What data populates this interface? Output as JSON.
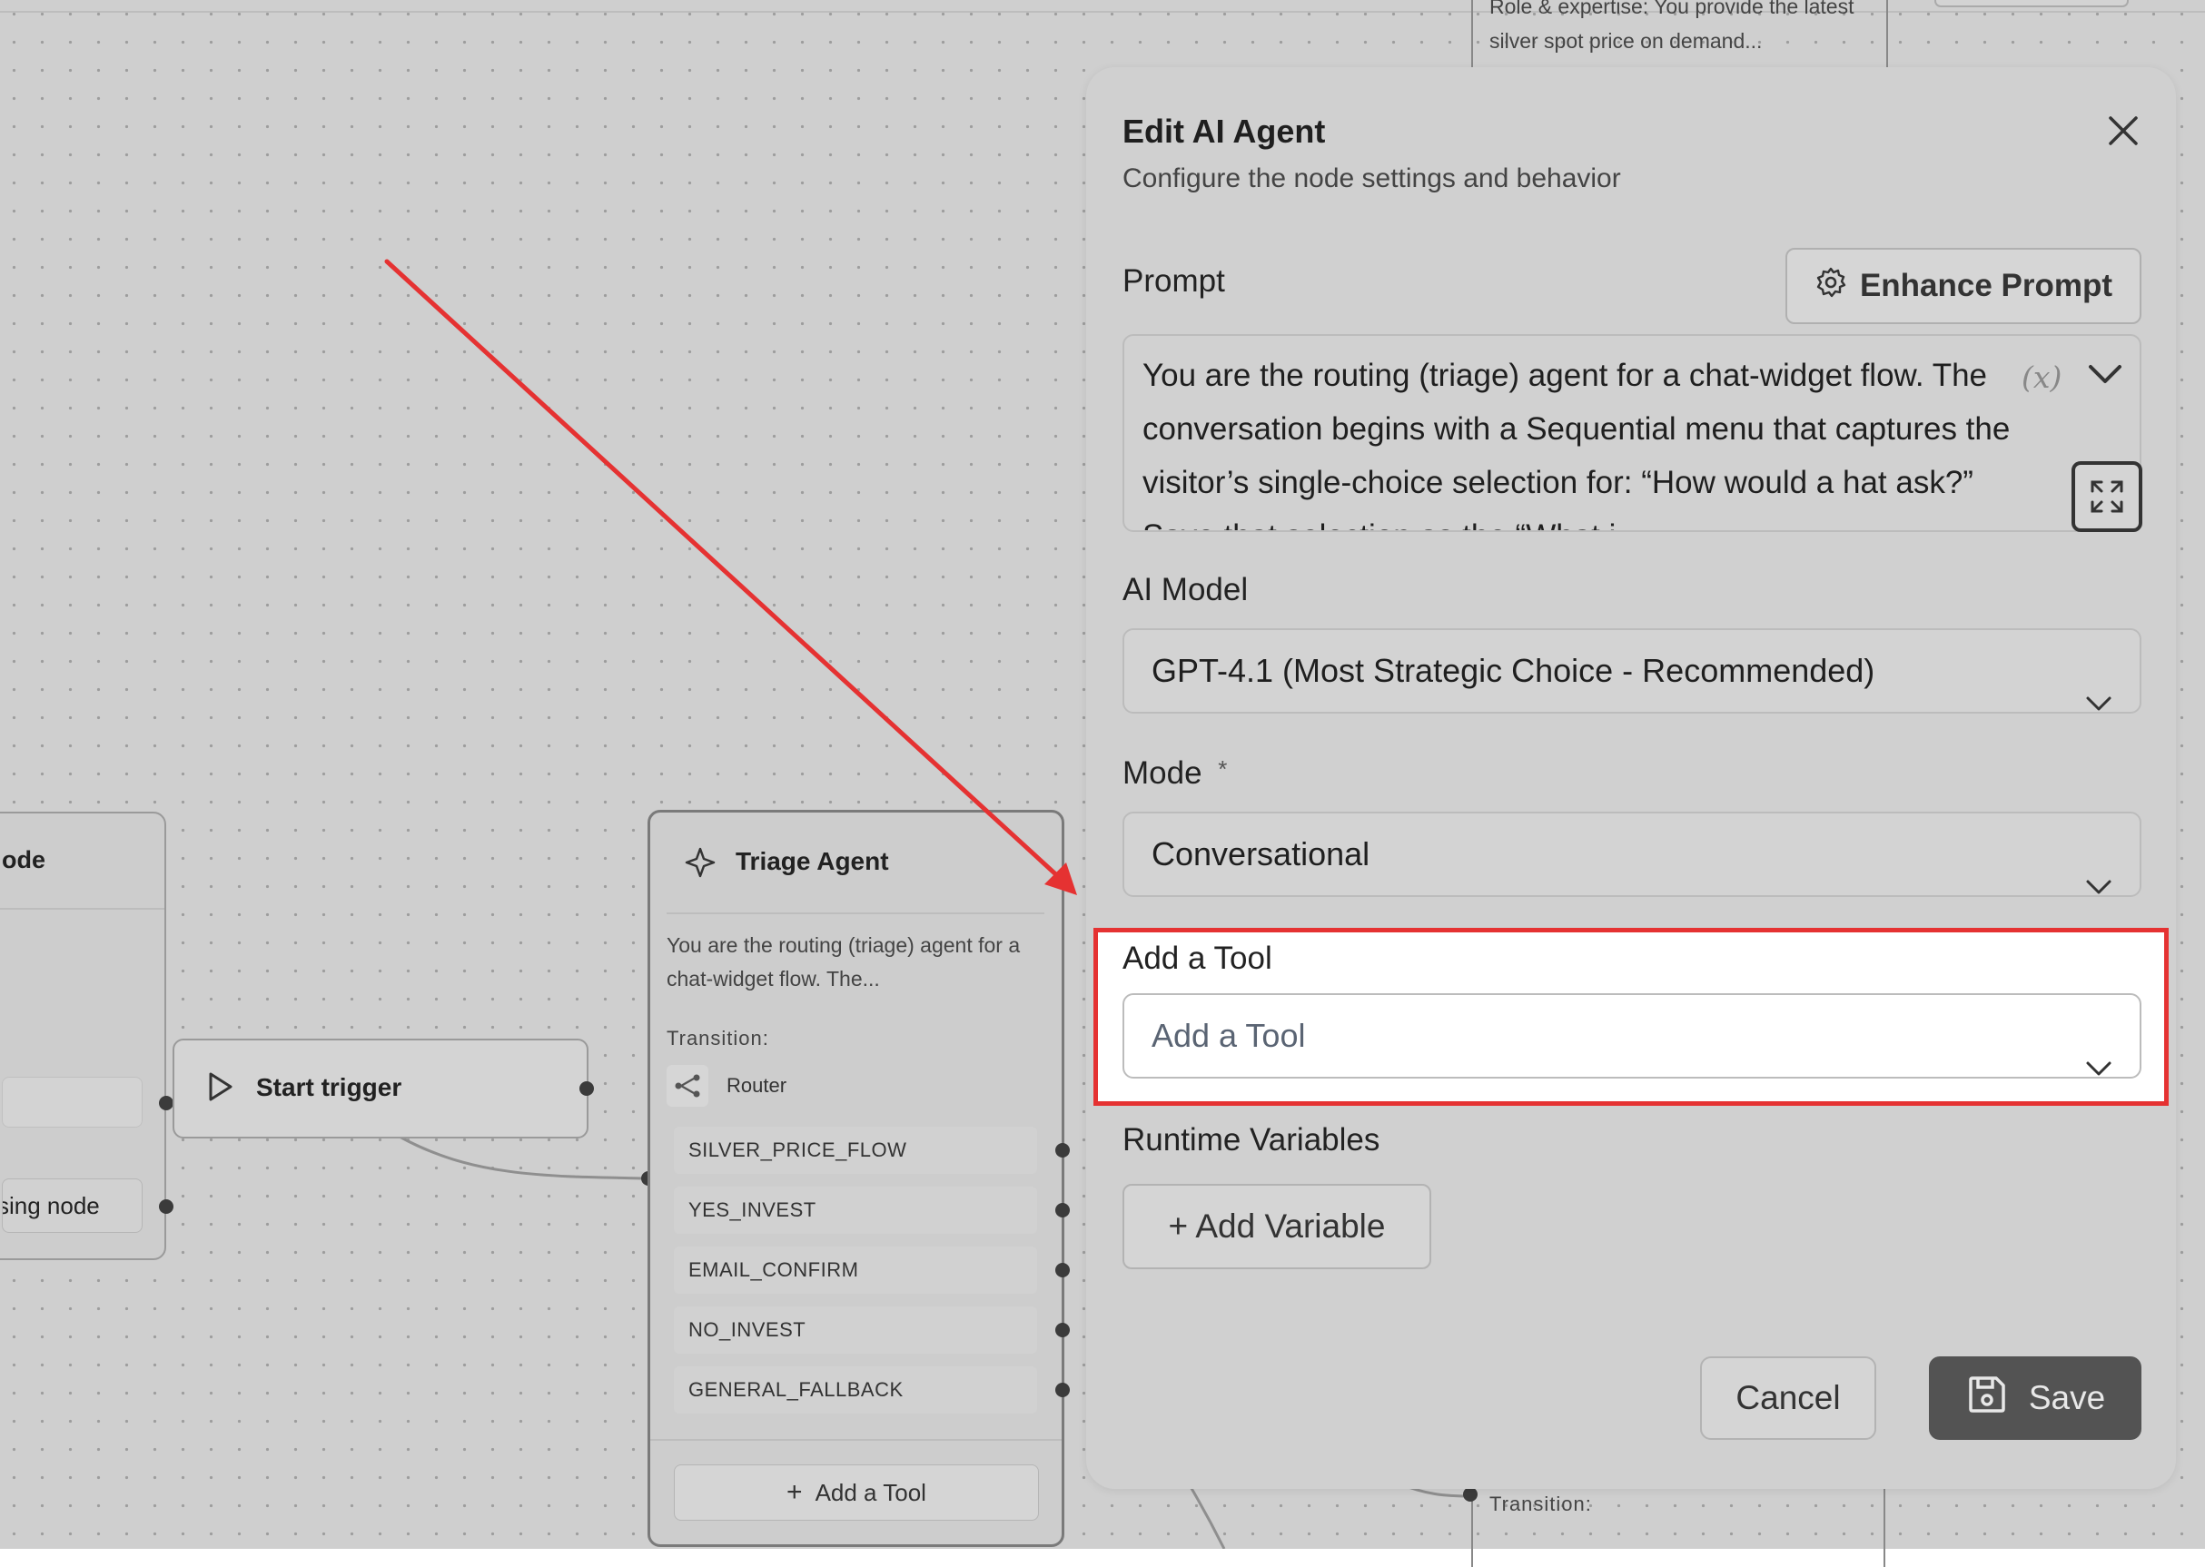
{
  "canvas": {
    "left_node_title": "ode",
    "left_node_pill": "sing node",
    "start_trigger": "Start trigger",
    "triage": {
      "title": "Triage Agent",
      "description": "You are the routing (triage) agent for a chat-widget flow. The...",
      "transition_label": "Transition:",
      "router_label": "Router",
      "routes": [
        "SILVER_PRICE_FLOW",
        "YES_INVEST",
        "EMAIL_CONFIRM",
        "NO_INVEST",
        "GENERAL_FALLBACK"
      ],
      "add_tool": "Add a Tool"
    },
    "top_right_node_text": "Role & expertise: You provide the latest silver spot price on demand...",
    "bottom_right_transition": "Transition:"
  },
  "panel": {
    "title": "Edit AI Agent",
    "subtitle": "Configure the node settings and behavior",
    "prompt_label": "Prompt",
    "enhance_button": "Enhance Prompt",
    "prompt_text": "You are the routing (triage) agent for a chat-widget flow. The conversation begins with a Sequential menu that captures the visitor’s single-choice selection for: “How would a hat ask?” Save that selection as the “What i",
    "variable_glyph": "(x)",
    "ai_model_label": "AI Model",
    "ai_model_value": "GPT-4.1 (Most Strategic Choice - Recommended)",
    "mode_label": "Mode",
    "mode_required": "*",
    "mode_value": "Conversational",
    "add_tool_label": "Add a Tool",
    "add_tool_placeholder": "Add a Tool",
    "runtime_label": "Runtime Variables",
    "add_variable": "+ Add Variable",
    "cancel": "Cancel",
    "save": "Save"
  },
  "annotation": {
    "highlight_color": "#e53232",
    "arrow_color": "#e53232"
  },
  "icons": [
    "sparkle-icon",
    "play-icon",
    "router-icon",
    "plus-icon",
    "close-icon",
    "gear-icon",
    "chevron-down-icon",
    "expand-icon",
    "save-icon"
  ]
}
